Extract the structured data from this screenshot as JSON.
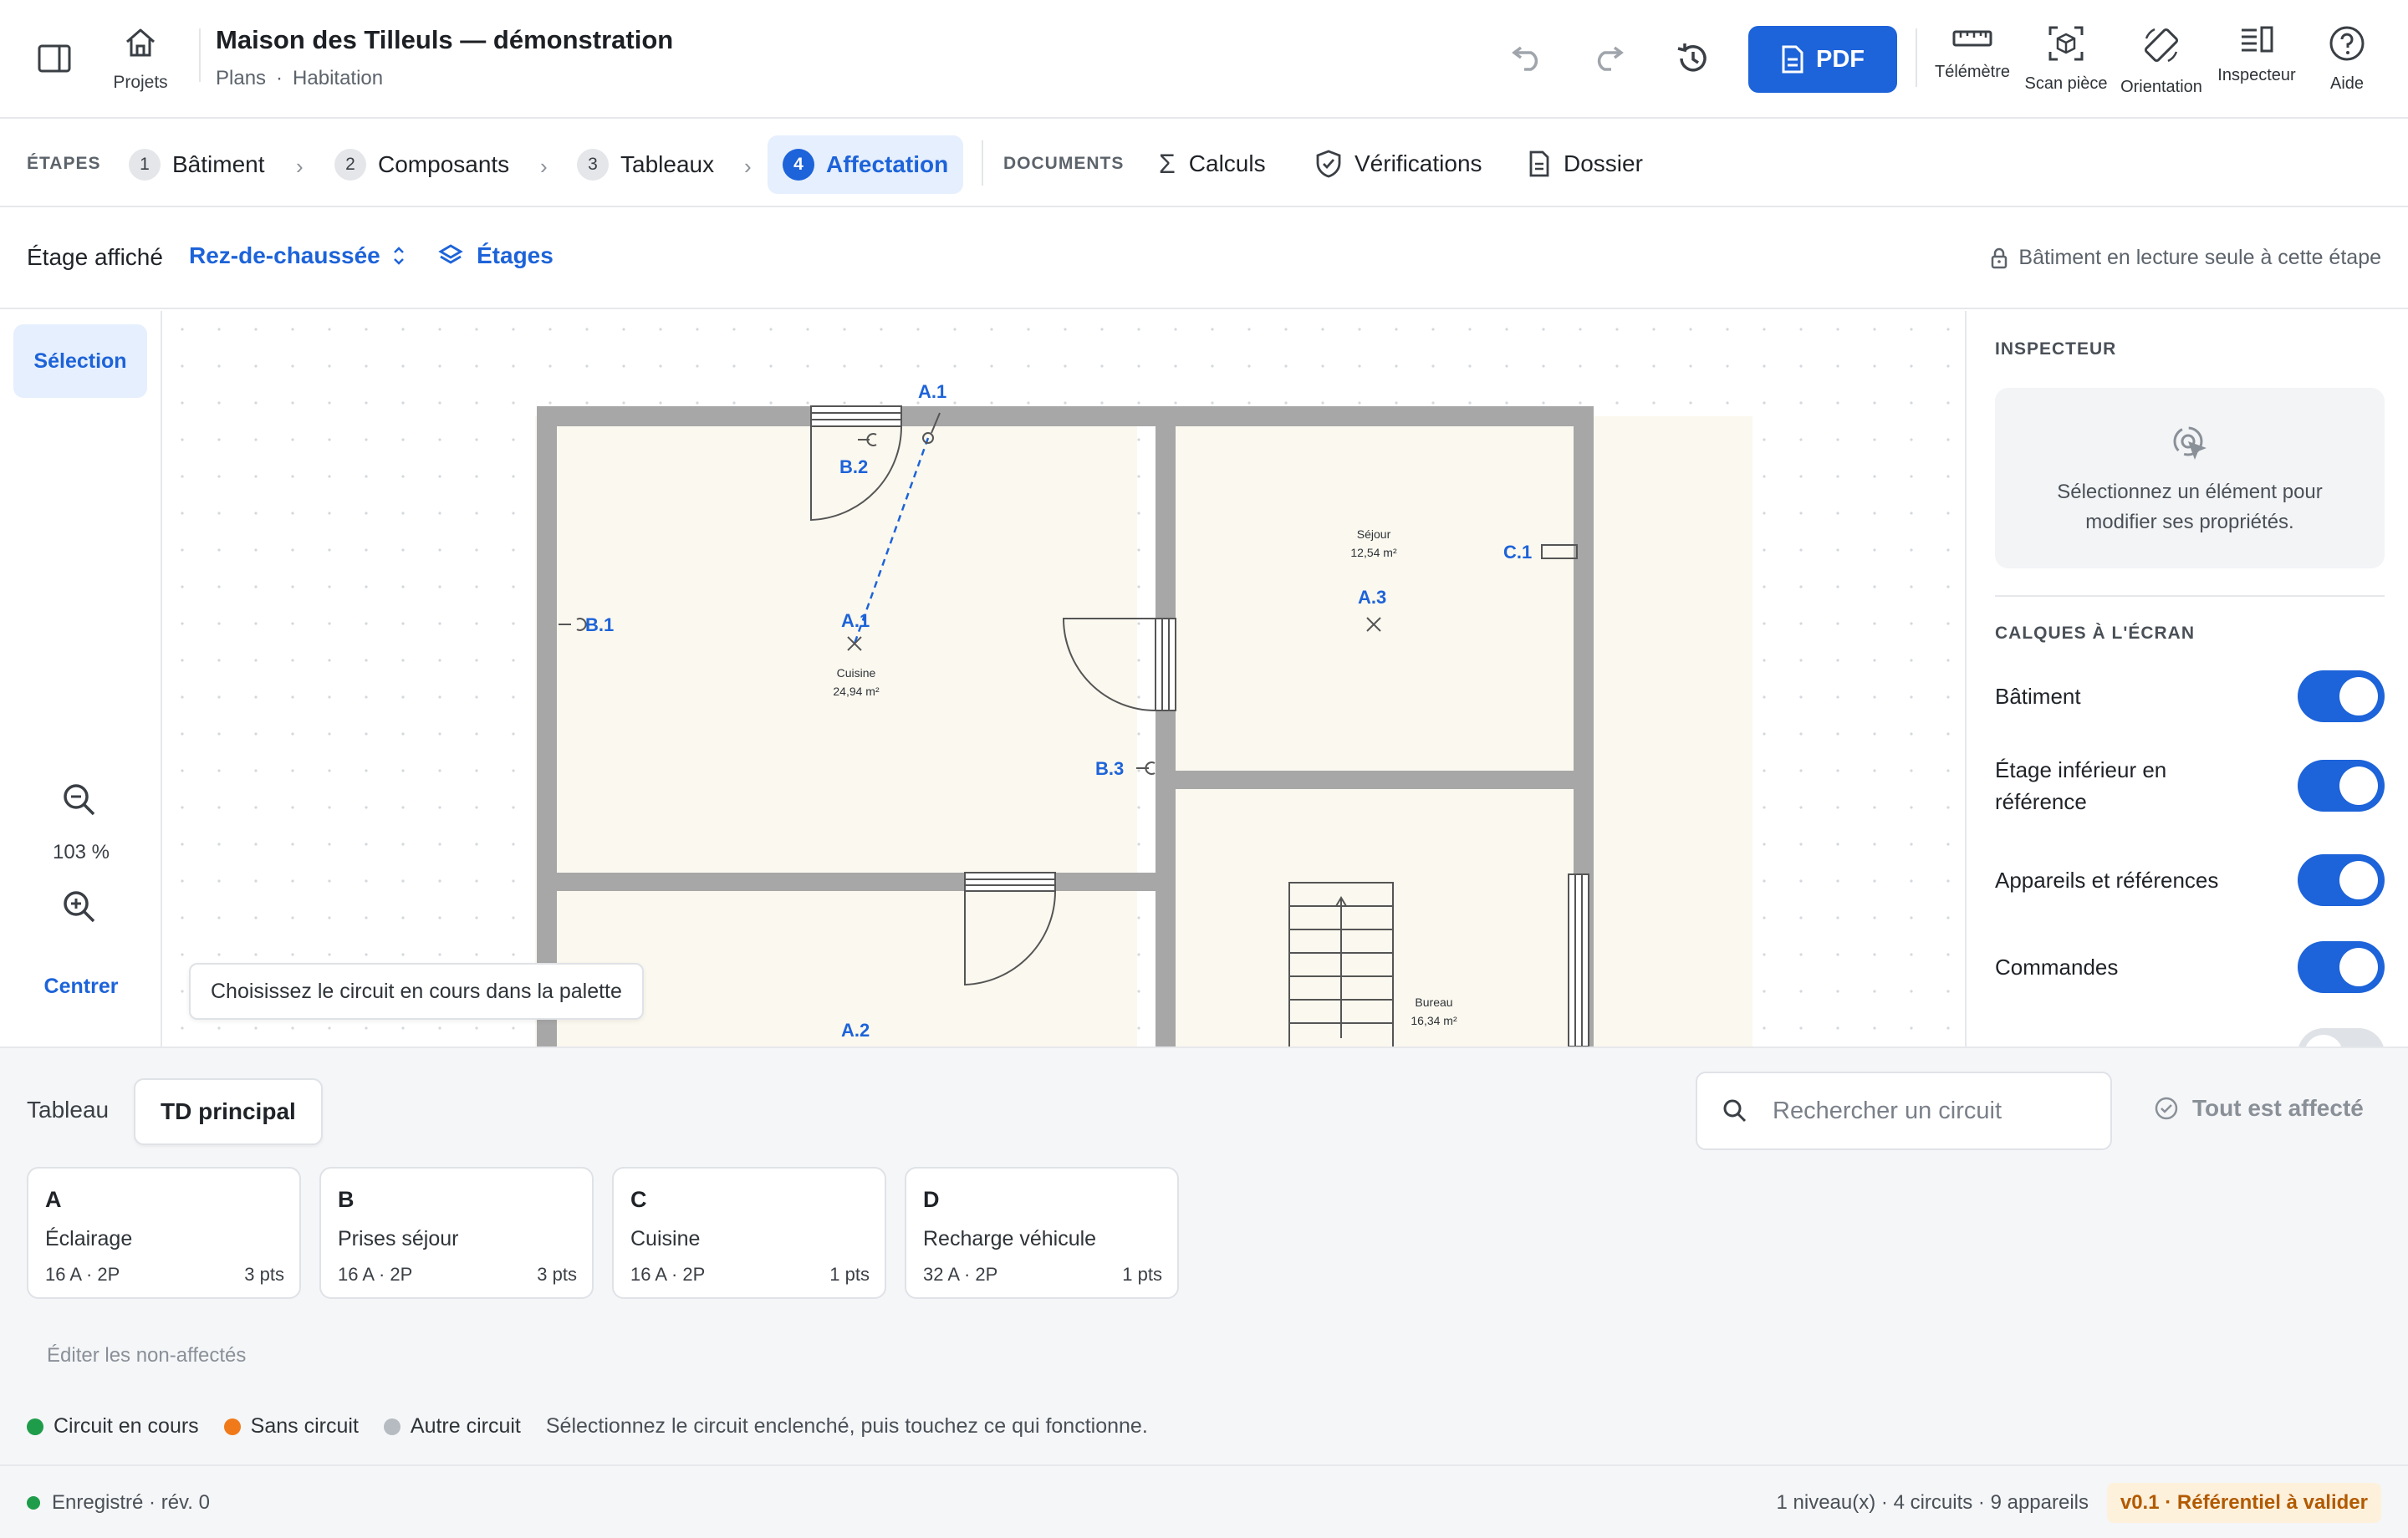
{
  "header": {
    "home_label": "Projets",
    "project_title": "Maison des Tilleuls — démonstration",
    "breadcrumb": [
      "Plans",
      "Habitation"
    ],
    "pdf_label": "PDF",
    "tools": [
      {
        "label": "Télémètre",
        "icon": "ruler-icon"
      },
      {
        "label": "Scan pièce",
        "icon": "scan-cube-icon"
      },
      {
        "label": "Orientation",
        "icon": "rotate-device-icon"
      },
      {
        "label": "Inspecteur",
        "icon": "inspector-panel-icon"
      },
      {
        "label": "Aide",
        "icon": "help-icon"
      }
    ]
  },
  "steps": {
    "label": "ÉTAPES",
    "items": [
      {
        "num": "1",
        "label": "Bâtiment"
      },
      {
        "num": "2",
        "label": "Composants"
      },
      {
        "num": "3",
        "label": "Tableaux"
      },
      {
        "num": "4",
        "label": "Affectation",
        "active": true
      }
    ],
    "docs_label": "DOCUMENTS",
    "docs": [
      {
        "label": "Calculs",
        "icon": "sigma-icon"
      },
      {
        "label": "Vérifications",
        "icon": "shield-check-icon"
      },
      {
        "label": "Dossier",
        "icon": "document-icon"
      }
    ]
  },
  "floorbar": {
    "label": "Étage affiché",
    "selected_floor": "Rez-de-chaussée",
    "floors_button": "Étages",
    "readonly_notice": "Bâtiment en lecture seule à cette étape"
  },
  "lefttools": {
    "selection": "Sélection",
    "zoom": "103 %",
    "center": "Centrer"
  },
  "plan": {
    "hint": "Choisissez le circuit en cours dans la palette",
    "rooms": [
      {
        "name": "Cuisine",
        "area": "24,94 m²"
      },
      {
        "name": "Séjour",
        "area": "12,54 m²"
      },
      {
        "name": "Bureau",
        "area": "16,34 m²"
      }
    ],
    "labels": [
      "A.1",
      "B.2",
      "A.1",
      "B.1",
      "A.3",
      "C.1",
      "B.3",
      "A.2"
    ],
    "accent": "#1d63d9"
  },
  "inspector": {
    "title": "INSPECTEUR",
    "empty_text": "Sélectionnez un élément pour modifier ses propriétés.",
    "layers_title": "CALQUES À L'ÉCRAN",
    "layers": [
      {
        "name": "Bâtiment",
        "on": true
      },
      {
        "name": "Étage inférieur en référence",
        "on": true
      },
      {
        "name": "Appareils et références",
        "on": true
      },
      {
        "name": "Commandes",
        "on": true
      }
    ]
  },
  "palette": {
    "tableau_label": "Tableau",
    "active_board": "TD principal",
    "search_placeholder": "Rechercher un circuit",
    "all_assigned": "Tout est affecté",
    "circuits": [
      {
        "letter": "A",
        "name": "Éclairage",
        "spec": "16 A · 2P",
        "pts": "3 pts"
      },
      {
        "letter": "B",
        "name": "Prises séjour",
        "spec": "16 A · 2P",
        "pts": "3 pts"
      },
      {
        "letter": "C",
        "name": "Cuisine",
        "spec": "16 A · 2P",
        "pts": "1 pts"
      },
      {
        "letter": "D",
        "name": "Recharge véhicule",
        "spec": "32 A · 2P",
        "pts": "1 pts"
      }
    ],
    "edit_unassigned": "Éditer les non-affectés",
    "legend": [
      {
        "label": "Circuit en cours",
        "color": "#1e9c4a"
      },
      {
        "label": "Sans circuit",
        "color": "#f07a1a"
      },
      {
        "label": "Autre circuit",
        "color": "#b6bbc2"
      }
    ],
    "legend_help": "Sélectionnez le circuit enclenché, puis touchez ce qui fonctionne."
  },
  "status": {
    "saved": "Enregistré · rév. 0",
    "counts": "1 niveau(x) · 4 circuits · 9 appareils",
    "version": "v0.1 · Référentiel à valider"
  }
}
